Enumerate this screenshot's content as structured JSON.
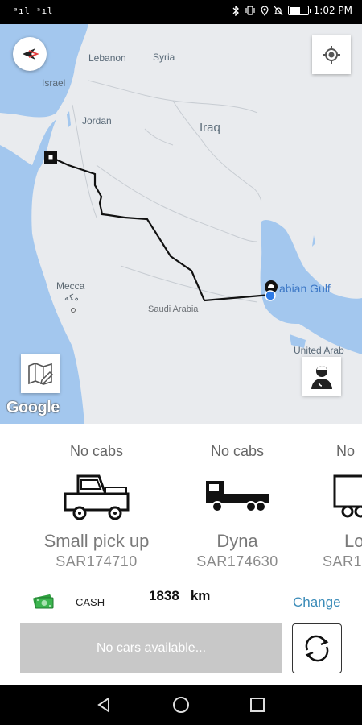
{
  "status_bar": {
    "signal": "ᵃıl ᵃıl",
    "time": "1:02 PM",
    "icons": [
      "bluetooth-icon",
      "vibrate-icon",
      "location-icon",
      "mute-icon",
      "battery-icon"
    ]
  },
  "map": {
    "labels": {
      "lebanon": "Lebanon",
      "syria": "Syria",
      "israel": "Israel",
      "jordan": "Jordan",
      "iraq": "Iraq",
      "gulf": "abian Gulf",
      "mecca": "Mecca",
      "mecca_ar": "مكة",
      "saudi": "Saudi Arabia",
      "uae": "United Arab"
    },
    "google": "Google",
    "colors": {
      "water": "#a3c7ee",
      "land": "#e9ebee",
      "route": "#111111",
      "origin": "#2f7be5"
    }
  },
  "vehicles": [
    {
      "status": "No cabs",
      "name": "Small pick up",
      "price": "SAR174710",
      "icon": "pickup-truck-icon"
    },
    {
      "status": "No cabs",
      "name": "Dyna",
      "price": "SAR174630",
      "icon": "flatbed-truck-icon"
    },
    {
      "status": "No",
      "name": "Lo",
      "price": "SAR1",
      "icon": "box-truck-icon"
    }
  ],
  "payment": {
    "method": "CASH",
    "distance_value": "1838",
    "distance_unit": "km",
    "change_label": "Change",
    "icon": "cash-icon"
  },
  "actions": {
    "no_cars_label": "No cars available...",
    "refresh_icon": "refresh-icon"
  },
  "nav": {
    "icons": [
      "back-icon",
      "home-icon",
      "recents-icon"
    ]
  }
}
